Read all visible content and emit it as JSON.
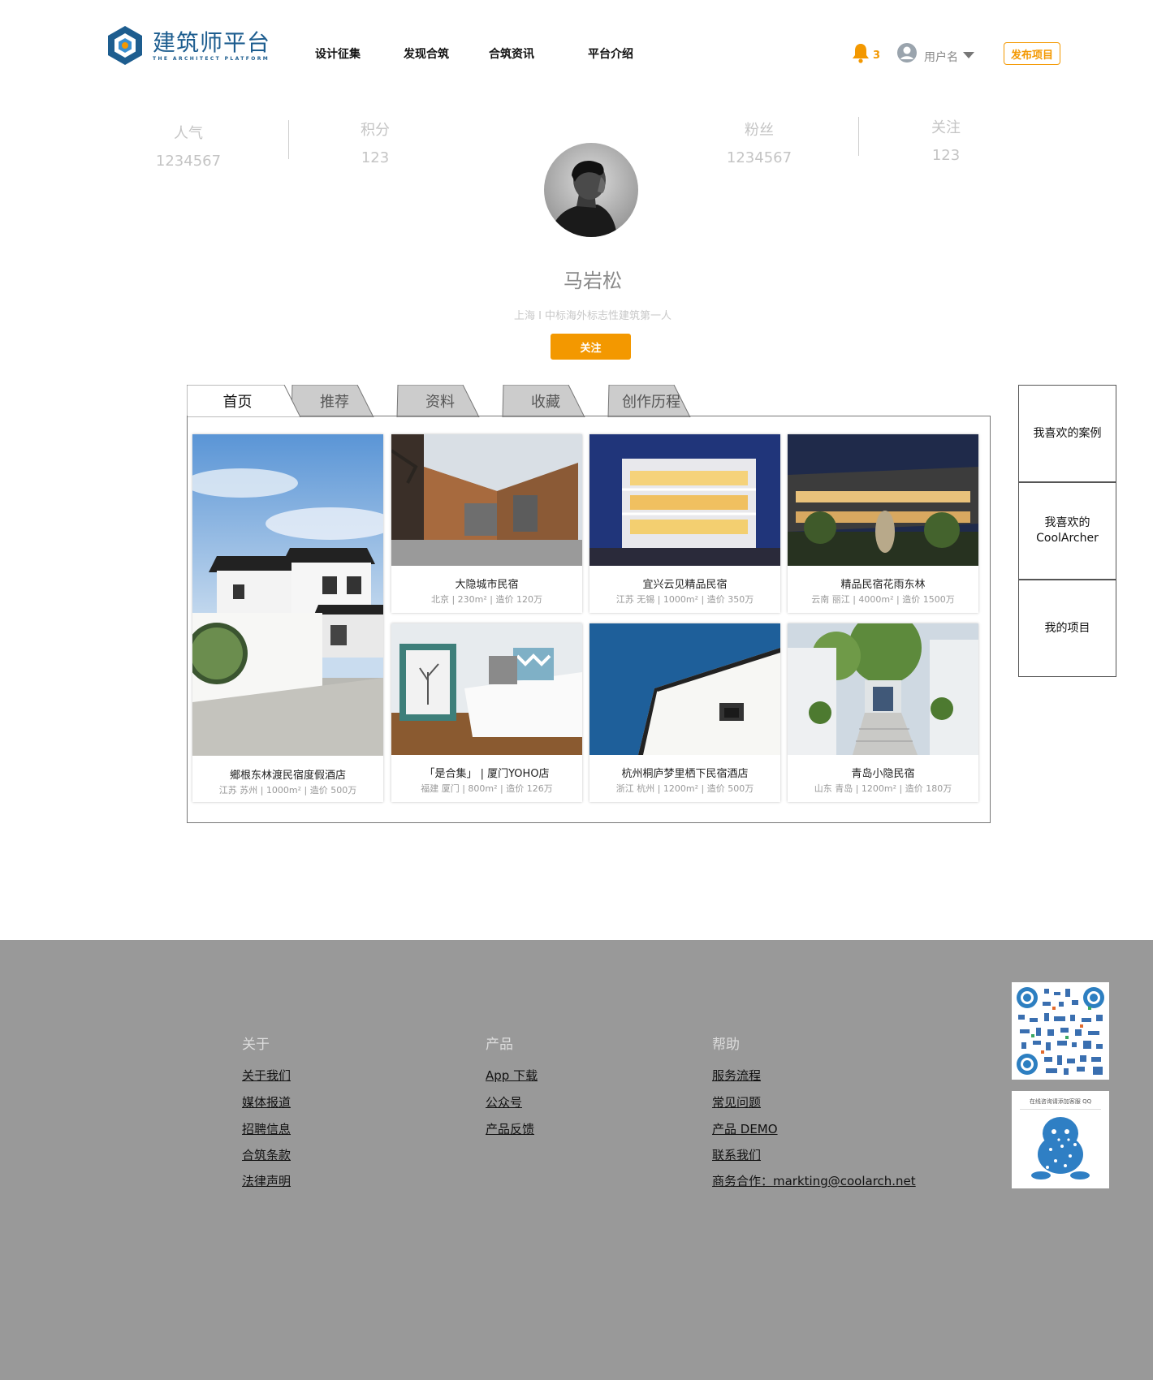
{
  "header": {
    "logo_cn": "建筑师平台",
    "logo_en": "THE ARCHITECT PLATFORM",
    "nav": [
      "设计征集",
      "发现合筑",
      "合筑资讯",
      "平台介绍"
    ],
    "notification_count": "3",
    "username": "用户名",
    "publish_label": "发布项目"
  },
  "stats": {
    "popularity_label": "人气",
    "popularity_value": "1234567",
    "points_label": "积分",
    "points_value": "123",
    "fans_label": "粉丝",
    "fans_value": "1234567",
    "following_label": "关注",
    "following_value": "123"
  },
  "profile": {
    "name": "马岩松",
    "description": "上海 I 中标海外标志性建筑第一人",
    "follow_label": "关注"
  },
  "tabs": [
    "首页",
    "推荐",
    "资料",
    "收藏",
    "创作历程"
  ],
  "active_tab": "首页",
  "projects": [
    {
      "title": "鄉根东林渡民宿度假酒店",
      "meta": "江苏 苏州 | 1000m² | 造价 500万"
    },
    {
      "title": "大隐城市民宿",
      "meta": "北京 | 230m² | 造价 120万"
    },
    {
      "title": "宜兴云见精品民宿",
      "meta": "江苏 无锡 | 1000m² | 造价 350万"
    },
    {
      "title": "精品民宿花雨东林",
      "meta": "云南 丽江 | 4000m² | 造价 1500万"
    },
    {
      "title": "「是合集」 | 厦门YOHO店",
      "meta": "福建 厦门 | 800m² | 造价 126万"
    },
    {
      "title": "杭州桐庐梦里栖下民宿酒店",
      "meta": "浙江 杭州 | 1200m² | 造价 500万"
    },
    {
      "title": "青岛小隐民宿",
      "meta": "山东 青岛 | 1200m² | 造价 180万"
    }
  ],
  "side_panel": {
    "liked_cases": "我喜欢的案例",
    "liked_coolarcher_1": "我喜欢的",
    "liked_coolarcher_2": "CoolArcher",
    "my_projects": "我的项目"
  },
  "footer": {
    "about_title": "关于",
    "about_links": [
      "关于我们",
      "媒体报道",
      "招聘信息",
      "合筑条款",
      "法律声明"
    ],
    "product_title": "产品",
    "product_links": [
      "App 下载",
      "公众号",
      "产品反馈"
    ],
    "help_title": "帮助",
    "help_links": [
      "服务流程",
      "常见问题",
      "产品 DEMO",
      "联系我们",
      "商务合作：markting@coolarch.net"
    ],
    "qq_caption": "在线咨询请添加客服 QQ"
  },
  "colors": {
    "accent": "#f39800",
    "brand_blue": "#1d5d8f",
    "footer_bg": "#999999",
    "tab_inactive": "#cccccc"
  }
}
